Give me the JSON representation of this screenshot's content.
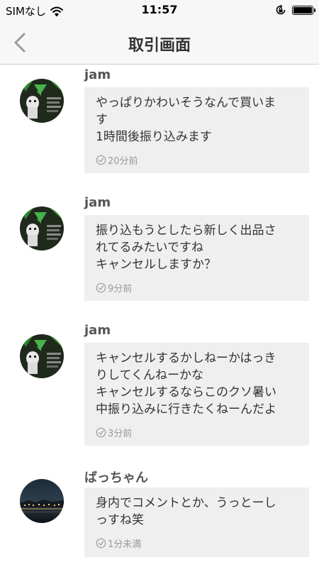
{
  "status_bar": {
    "carrier": "SIMなし",
    "time": "11:57"
  },
  "nav": {
    "title": "取引画面"
  },
  "messages": [
    {
      "sender": "jam",
      "text": "やっぱりかわいそうなんで買いま\nす\n1時間後振り込みます",
      "time": "20分前"
    },
    {
      "sender": "jam",
      "text": "振り込もうとしたら新しく出品さ\nれてるみたいですね\nキャンセルしますか？",
      "time": "9分前"
    },
    {
      "sender": "jam",
      "text": "キャンセルするかしねーかはっき\nりしてくんねーかな\nキャンセルするならこのクソ暑い\n中振り込みに行きたくねーんだよ",
      "time": "3分前"
    },
    {
      "sender": "ばっちゃん",
      "text": "身内でコメントとか、うっとーし\nっすね笑",
      "time": "1分未満"
    }
  ],
  "icons": {
    "wifi": "wifi-icon",
    "rotation_lock": "rotation-lock-icon",
    "battery": "battery-icon",
    "back": "chevron-left-icon",
    "clock": "clock-icon"
  },
  "colors": {
    "bar_background": "#f7f7f7",
    "bubble_background": "#efefef",
    "timestamp": "#999999",
    "sender_name": "#555555"
  }
}
